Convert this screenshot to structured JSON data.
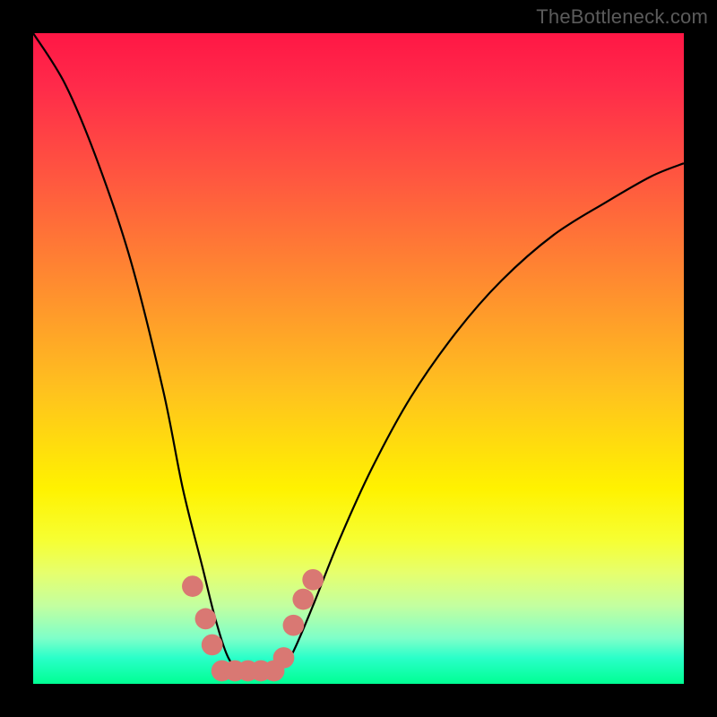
{
  "watermark": "TheBottleneck.com",
  "domain": "Chart",
  "colors": {
    "gradient_top": "#ff1745",
    "gradient_mid": "#fff200",
    "gradient_bottom": "#00ff93",
    "curve": "#000000",
    "marker": "#d97873",
    "frame": "#000000"
  },
  "chart_data": {
    "type": "line",
    "title": "",
    "xlabel": "",
    "ylabel": "",
    "xlim": [
      0,
      100
    ],
    "ylim": [
      0,
      100
    ],
    "grid": false,
    "legend": null,
    "description": "Two black curves descending to a common valley near x≈28–38 against a vertical red→yellow→green gradient background. Salmon-colored dot markers cluster at the valley floor and its walls.",
    "series": [
      {
        "name": "left-curve",
        "x": [
          0,
          5,
          10,
          15,
          20,
          23,
          26,
          28,
          30,
          32,
          34,
          36,
          38
        ],
        "y": [
          100,
          92,
          80,
          65,
          45,
          30,
          18,
          10,
          4,
          2,
          2,
          2,
          2
        ]
      },
      {
        "name": "right-curve",
        "x": [
          38,
          40,
          43,
          47,
          52,
          58,
          65,
          72,
          80,
          88,
          95,
          100
        ],
        "y": [
          2,
          5,
          12,
          22,
          33,
          44,
          54,
          62,
          69,
          74,
          78,
          80
        ]
      }
    ],
    "markers": [
      {
        "x": 24.5,
        "y": 15,
        "r": 1.2
      },
      {
        "x": 26.5,
        "y": 10,
        "r": 1.2
      },
      {
        "x": 27.5,
        "y": 6,
        "r": 1.2
      },
      {
        "x": 29,
        "y": 2,
        "r": 1.2
      },
      {
        "x": 31,
        "y": 2,
        "r": 1.2
      },
      {
        "x": 33,
        "y": 2,
        "r": 1.2
      },
      {
        "x": 35,
        "y": 2,
        "r": 1.2
      },
      {
        "x": 37,
        "y": 2,
        "r": 1.2
      },
      {
        "x": 38.5,
        "y": 4,
        "r": 1.2
      },
      {
        "x": 40,
        "y": 9,
        "r": 1.2
      },
      {
        "x": 41.5,
        "y": 13,
        "r": 1.2
      },
      {
        "x": 43,
        "y": 16,
        "r": 1.2
      }
    ]
  }
}
